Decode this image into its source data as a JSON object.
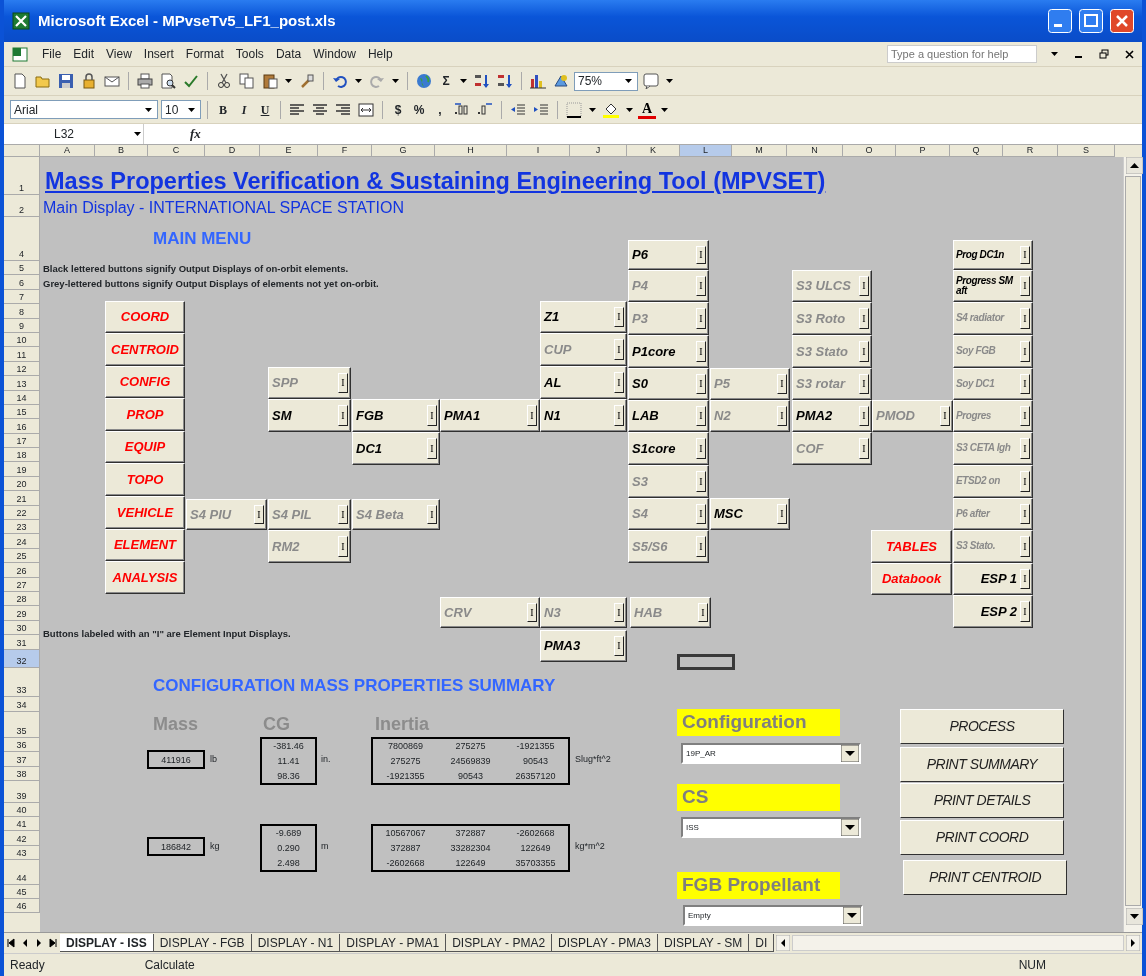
{
  "window": {
    "title": "Microsoft Excel - MPvseTv5_LF1_post.xls"
  },
  "menu": [
    "File",
    "Edit",
    "View",
    "Insert",
    "Format",
    "Tools",
    "Data",
    "Window",
    "Help"
  ],
  "help_box": {
    "placeholder": "Type a question for help"
  },
  "toolbar": {
    "autosum": "Σ",
    "zoom": "75%"
  },
  "format_toolbar": {
    "font": "Arial",
    "size": "10",
    "styles": [
      "B",
      "I",
      "U"
    ],
    "number_formats": [
      "$",
      "%",
      ","
    ],
    "font_color": "A"
  },
  "formula_bar": {
    "name_box": "L32",
    "function_label": "fx"
  },
  "columns": [
    {
      "label": "A",
      "selected": false
    },
    {
      "label": "B",
      "selected": false
    },
    {
      "label": "C",
      "selected": false
    },
    {
      "label": "D",
      "selected": false
    },
    {
      "label": "E",
      "selected": false
    },
    {
      "label": "F",
      "selected": false
    },
    {
      "label": "G",
      "selected": false
    },
    {
      "label": "H",
      "selected": false
    },
    {
      "label": "I",
      "selected": false
    },
    {
      "label": "J",
      "selected": false
    },
    {
      "label": "K",
      "selected": false
    },
    {
      "label": "L",
      "selected": true
    },
    {
      "label": "M",
      "selected": false
    },
    {
      "label": "N",
      "selected": false
    },
    {
      "label": "O",
      "selected": false
    },
    {
      "label": "P",
      "selected": false
    },
    {
      "label": "Q",
      "selected": false
    },
    {
      "label": "R",
      "selected": false
    },
    {
      "label": "S",
      "selected": false
    }
  ],
  "rows": [
    {
      "label": "1",
      "selected": false
    },
    {
      "label": "2",
      "selected": false
    },
    {
      "label": "4",
      "selected": false
    },
    {
      "label": "5",
      "selected": false
    },
    {
      "label": "6",
      "selected": false
    },
    {
      "label": "7",
      "selected": false
    },
    {
      "label": "8",
      "selected": false
    },
    {
      "label": "9",
      "selected": false
    },
    {
      "label": "10",
      "selected": false
    },
    {
      "label": "11",
      "selected": false
    },
    {
      "label": "12",
      "selected": false
    },
    {
      "label": "13",
      "selected": false
    },
    {
      "label": "14",
      "selected": false
    },
    {
      "label": "15",
      "selected": false
    },
    {
      "label": "16",
      "selected": false
    },
    {
      "label": "17",
      "selected": false
    },
    {
      "label": "18",
      "selected": false
    },
    {
      "label": "19",
      "selected": false
    },
    {
      "label": "20",
      "selected": false
    },
    {
      "label": "21",
      "selected": false
    },
    {
      "label": "22",
      "selected": false
    },
    {
      "label": "23",
      "selected": false
    },
    {
      "label": "24",
      "selected": false
    },
    {
      "label": "25",
      "selected": false
    },
    {
      "label": "26",
      "selected": false
    },
    {
      "label": "27",
      "selected": false
    },
    {
      "label": "28",
      "selected": false
    },
    {
      "label": "29",
      "selected": false
    },
    {
      "label": "30",
      "selected": false
    },
    {
      "label": "31",
      "selected": false
    },
    {
      "label": "32",
      "selected": true
    },
    {
      "label": "33",
      "selected": false
    },
    {
      "label": "34",
      "selected": false
    },
    {
      "label": "35",
      "selected": false
    },
    {
      "label": "36",
      "selected": false
    },
    {
      "label": "37",
      "selected": false
    },
    {
      "label": "38",
      "selected": false
    },
    {
      "label": "39",
      "selected": false
    },
    {
      "label": "40",
      "selected": false
    },
    {
      "label": "41",
      "selected": false
    },
    {
      "label": "42",
      "selected": false
    },
    {
      "label": "43",
      "selected": false
    },
    {
      "label": "44",
      "selected": false
    },
    {
      "label": "45",
      "selected": false
    },
    {
      "label": "46",
      "selected": false
    }
  ],
  "sheet": {
    "title": "Mass Properties Verification & Sustaining Engineering Tool (MPVSET)",
    "subtitle": "Main Display - INTERNATIONAL SPACE STATION",
    "menu_heading": "MAIN MENU",
    "notes": [
      "Black lettered buttons signify Output Displays of on-orbit elements.",
      "Grey-lettered buttons signify Output Displays of elements not yet on-orbit."
    ],
    "input_note": "Buttons labeled with an \"I\" are Element Input Displays."
  },
  "buttons": [
    {
      "label": "COORD",
      "kind": "menu"
    },
    {
      "label": "CENTROID",
      "kind": "menu"
    },
    {
      "label": "CONFIG",
      "kind": "menu"
    },
    {
      "label": "PROP",
      "kind": "menu"
    },
    {
      "label": "EQUIP",
      "kind": "menu"
    },
    {
      "label": "TOPO",
      "kind": "menu"
    },
    {
      "label": "VEHICLE",
      "kind": "menu"
    },
    {
      "label": "ELEMENT",
      "kind": "menu"
    },
    {
      "label": "ANALYSIS",
      "kind": "menu"
    },
    {
      "label": "TABLES",
      "kind": "menu"
    },
    {
      "label": "Databook",
      "kind": "menu"
    },
    {
      "label": "P6",
      "kind": "element",
      "on_orbit": true,
      "input": "I"
    },
    {
      "label": "P4",
      "kind": "element",
      "on_orbit": false,
      "input": "I"
    },
    {
      "label": "P3",
      "kind": "element",
      "on_orbit": false,
      "input": "I"
    },
    {
      "label": "P1core",
      "kind": "element",
      "on_orbit": true,
      "input": "I"
    },
    {
      "label": "S0",
      "kind": "element",
      "on_orbit": true,
      "input": "I"
    },
    {
      "label": "LAB",
      "kind": "element",
      "on_orbit": true,
      "input": "I"
    },
    {
      "label": "S1core",
      "kind": "element",
      "on_orbit": true,
      "input": "I"
    },
    {
      "label": "S3",
      "kind": "element",
      "on_orbit": false,
      "input": "I"
    },
    {
      "label": "S4",
      "kind": "element",
      "on_orbit": false,
      "input": "I"
    },
    {
      "label": "S5/S6",
      "kind": "element",
      "on_orbit": false,
      "input": "I"
    },
    {
      "label": "Z1",
      "kind": "element",
      "on_orbit": true,
      "input": "I"
    },
    {
      "label": "CUP",
      "kind": "element",
      "on_orbit": false,
      "input": "I"
    },
    {
      "label": "AL",
      "kind": "element",
      "on_orbit": true,
      "input": "I"
    },
    {
      "label": "N1",
      "kind": "element",
      "on_orbit": true,
      "input": "I"
    },
    {
      "label": "N3",
      "kind": "element",
      "on_orbit": false,
      "input": "I"
    },
    {
      "label": "PMA3",
      "kind": "element",
      "on_orbit": true,
      "input": "I"
    },
    {
      "label": "HAB",
      "kind": "element",
      "on_orbit": false,
      "input": "I"
    },
    {
      "label": "SPP",
      "kind": "element",
      "on_orbit": false,
      "input": "I"
    },
    {
      "label": "SM",
      "kind": "element",
      "on_orbit": true,
      "input": "I"
    },
    {
      "label": "FGB",
      "kind": "element",
      "on_orbit": true,
      "input": "I"
    },
    {
      "label": "DC1",
      "kind": "element",
      "on_orbit": true,
      "input": "I"
    },
    {
      "label": "PMA1",
      "kind": "element",
      "on_orbit": true,
      "input": "I"
    },
    {
      "label": "S4 PIU",
      "kind": "element",
      "on_orbit": false,
      "input": "I"
    },
    {
      "label": "S4 PIL",
      "kind": "element",
      "on_orbit": false,
      "input": "I"
    },
    {
      "label": "S4 Beta",
      "kind": "element",
      "on_orbit": false,
      "input": "I"
    },
    {
      "label": "RM2",
      "kind": "element",
      "on_orbit": false,
      "input": "I"
    },
    {
      "label": "CRV",
      "kind": "element",
      "on_orbit": false,
      "input": "I"
    },
    {
      "label": "P5",
      "kind": "element",
      "on_orbit": false,
      "input": "I"
    },
    {
      "label": "N2",
      "kind": "element",
      "on_orbit": false,
      "input": "I"
    },
    {
      "label": "MSC",
      "kind": "element",
      "on_orbit": true,
      "input": "I"
    },
    {
      "label": "S3 ULCS",
      "kind": "element",
      "on_orbit": false,
      "input": "I"
    },
    {
      "label": "S3 Roto",
      "kind": "element",
      "on_orbit": false,
      "input": "I"
    },
    {
      "label": "S3 Stato",
      "kind": "element",
      "on_orbit": false,
      "input": "I"
    },
    {
      "label": "S3 rotar",
      "kind": "element",
      "on_orbit": false,
      "input": "I"
    },
    {
      "label": "PMA2",
      "kind": "element",
      "on_orbit": true,
      "input": "I"
    },
    {
      "label": "COF",
      "kind": "element",
      "on_orbit": false,
      "input": "I"
    },
    {
      "label": "PMOD",
      "kind": "element",
      "on_orbit": false,
      "input": "I"
    },
    {
      "label": "Prog DC1n",
      "kind": "element",
      "on_orbit": true,
      "input": "I"
    },
    {
      "label": "Progress SM aft",
      "kind": "element",
      "on_orbit": true,
      "input": "I"
    },
    {
      "label": "S4 radiator",
      "kind": "element",
      "on_orbit": false,
      "input": "I"
    },
    {
      "label": "Soy FGB",
      "kind": "element",
      "on_orbit": false,
      "input": "I"
    },
    {
      "label": "Soy DC1",
      "kind": "element",
      "on_orbit": false,
      "input": "I"
    },
    {
      "label": "Progres",
      "kind": "element",
      "on_orbit": false,
      "input": "I"
    },
    {
      "label": "S3 CETA lgh",
      "kind": "element",
      "on_orbit": false,
      "input": "I"
    },
    {
      "label": "ETSD2 on",
      "kind": "element",
      "on_orbit": false,
      "input": "I"
    },
    {
      "label": "P6 after",
      "kind": "element",
      "on_orbit": false,
      "input": "I"
    },
    {
      "label": "S3 Stato.",
      "kind": "element",
      "on_orbit": false,
      "input": "I"
    },
    {
      "label": "ESP 1",
      "kind": "element",
      "on_orbit": true,
      "input": "I"
    },
    {
      "label": "ESP 2",
      "kind": "element",
      "on_orbit": true,
      "input": "I"
    }
  ],
  "summary": {
    "heading": "CONFIGURATION MASS PROPERTIES SUMMARY",
    "headers": [
      "Mass",
      "CG",
      "Inertia"
    ],
    "sets": [
      {
        "mass": "411916",
        "mass_unit": "lb",
        "cg": [
          "-381.46",
          "11.41",
          "98.36"
        ],
        "cg_unit": "in.",
        "inertia": [
          [
            "7800869",
            "275275",
            "-1921355"
          ],
          [
            "275275",
            "24569839",
            "90543"
          ],
          [
            "-1921355",
            "90543",
            "26357120"
          ]
        ],
        "inertia_unit": "Slug*ft^2"
      },
      {
        "mass": "186842",
        "mass_unit": "kg",
        "cg": [
          "-9.689",
          "0.290",
          "2.498"
        ],
        "cg_unit": "m",
        "inertia": [
          [
            "10567067",
            "372887",
            "-2602668"
          ],
          [
            "372887",
            "33282304",
            "122649"
          ],
          [
            "-2602668",
            "122649",
            "35703355"
          ]
        ],
        "inertia_unit": "kg*m^2"
      }
    ]
  },
  "selectors": [
    {
      "label": "Configuration",
      "value": "19P_AR"
    },
    {
      "label": "CS",
      "value": "ISS"
    },
    {
      "label": "FGB Propellant",
      "value": "Empty"
    }
  ],
  "actions": [
    "PROCESS",
    "PRINT SUMMARY",
    "PRINT DETAILS",
    "PRINT COORD",
    "PRINT CENTROID"
  ],
  "sheet_tabs": [
    {
      "label": "DISPLAY - ISS",
      "selected": true
    },
    {
      "label": "DISPLAY - FGB",
      "selected": false
    },
    {
      "label": "DISPLAY - N1",
      "selected": false
    },
    {
      "label": "DISPLAY - PMA1",
      "selected": false
    },
    {
      "label": "DISPLAY - PMA2",
      "selected": false
    },
    {
      "label": "DISPLAY - PMA3",
      "selected": false
    },
    {
      "label": "DISPLAY - SM",
      "selected": false
    },
    {
      "label": "DI",
      "selected": false
    }
  ],
  "status_bar": {
    "mode": "Ready",
    "message": "Calculate",
    "indicator": "NUM"
  }
}
